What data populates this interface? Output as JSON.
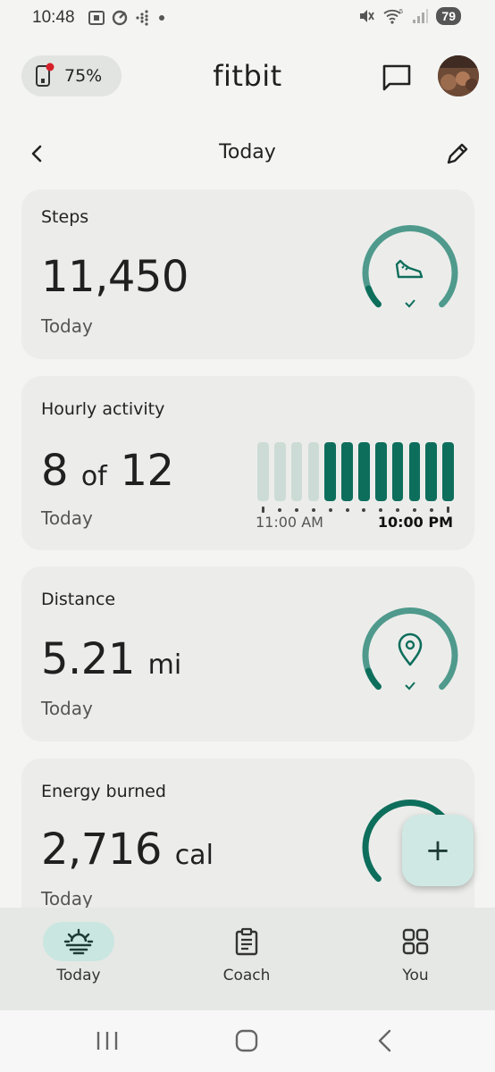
{
  "status_bar": {
    "time": "10:48",
    "battery": "79"
  },
  "header": {
    "device_battery": "75%",
    "app_title": "fitbit"
  },
  "nav": {
    "title": "Today"
  },
  "cards": {
    "steps": {
      "title": "Steps",
      "value": "11,450",
      "sub": "Today",
      "progress": 1.0
    },
    "hourly": {
      "title": "Hourly activity",
      "value_num": "8",
      "value_of": "of",
      "value_total": "12",
      "sub": "Today",
      "start_label": "11:00 AM",
      "end_label": "10:00 PM",
      "hours_active": [
        false,
        false,
        false,
        false,
        true,
        true,
        true,
        true,
        true,
        true,
        true,
        true
      ]
    },
    "distance": {
      "title": "Distance",
      "value": "5.21",
      "unit": "mi",
      "sub": "Today",
      "progress": 1.0
    },
    "energy": {
      "title": "Energy burned",
      "value": "2,716",
      "unit": "cal",
      "sub": "Today"
    }
  },
  "fab": {
    "label": "+"
  },
  "bottom_nav": {
    "items": [
      {
        "label": "Today",
        "icon": "sunrise-icon",
        "active": true
      },
      {
        "label": "Coach",
        "icon": "clipboard-icon",
        "active": false
      },
      {
        "label": "You",
        "icon": "grid-icon",
        "active": false
      }
    ]
  },
  "colors": {
    "accent": "#0e6e5c",
    "accent_light": "#4f9a8c",
    "inactive_bar": "#cddbd7",
    "card_bg": "#ecedeb"
  }
}
